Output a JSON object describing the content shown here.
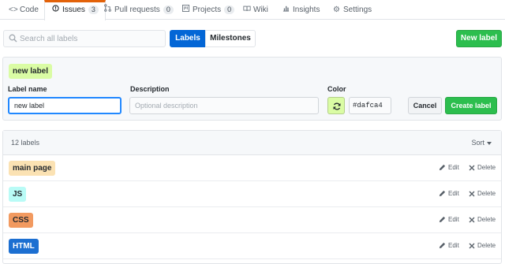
{
  "tabs": [
    {
      "label": "Code",
      "icon": "code-icon"
    },
    {
      "label": "Issues",
      "icon": "issue-opened-icon",
      "count": "3",
      "selected": true
    },
    {
      "label": "Pull requests",
      "icon": "git-pull-request-icon",
      "count": "0"
    },
    {
      "label": "Projects",
      "icon": "project-icon",
      "count": "0"
    },
    {
      "label": "Wiki",
      "icon": "book-icon"
    },
    {
      "label": "Insights",
      "icon": "graph-icon"
    },
    {
      "label": "Settings",
      "icon": "gear-icon"
    }
  ],
  "search": {
    "placeholder": "Search all labels",
    "icon": "search-icon"
  },
  "subnav": {
    "labels": "Labels",
    "milestones": "Milestones",
    "new_label": "New label"
  },
  "form": {
    "preview": "new label",
    "name_label": "Label name",
    "name_value": "new label",
    "description_label": "Description",
    "description_placeholder": "Optional description",
    "color_label": "Color",
    "color_value": "#dafca4",
    "refresh_icon": "sync-icon",
    "cancel": "Cancel",
    "create": "Create label"
  },
  "list": {
    "count": "12 labels",
    "sort": "Sort",
    "edit": "Edit",
    "delete": "Delete",
    "labels": [
      {
        "name": "main page",
        "color": "#fbe2b3",
        "text_color": "#24292e"
      },
      {
        "name": "JS",
        "color": "#b9fbf6",
        "text_color": "#24292e"
      },
      {
        "name": "CSS",
        "color": "#f29a60",
        "text_color": "#24292e"
      },
      {
        "name": "HTML",
        "color": "#1c6fd1",
        "text_color": "#ffffff"
      }
    ]
  },
  "colors": {
    "accent": "#0366d6",
    "green": "#2cbe4e",
    "tab_highlight": "#e36209"
  }
}
